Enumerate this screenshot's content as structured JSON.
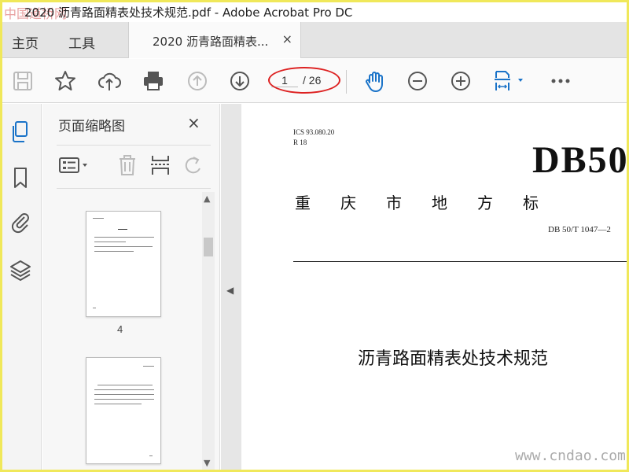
{
  "window": {
    "title": "2020 沥青路面精表处技术规范.pdf - Adobe Acrobat Pro DC",
    "watermark_logo": "中国道桥网"
  },
  "tabs": {
    "home": "主页",
    "tools": "工具",
    "document": "2020 沥青路面精表...",
    "close": "×"
  },
  "toolbar": {
    "current_page": "1",
    "total_pages": "/ 26",
    "accent": "#1a73c8",
    "highlight": "#d22222"
  },
  "panel": {
    "title": "页面缩略图",
    "close": "×",
    "thumbnail_page_number": "4"
  },
  "document": {
    "ics": "ICS 93.080.20",
    "r": "R 18",
    "big_title": "DB50",
    "standard_type": "重庆市地方标",
    "standard_no": "DB 50/T 1047—2",
    "doc_title": "沥青路面精表处技术规范"
  },
  "watermark": "www.cndao.com"
}
